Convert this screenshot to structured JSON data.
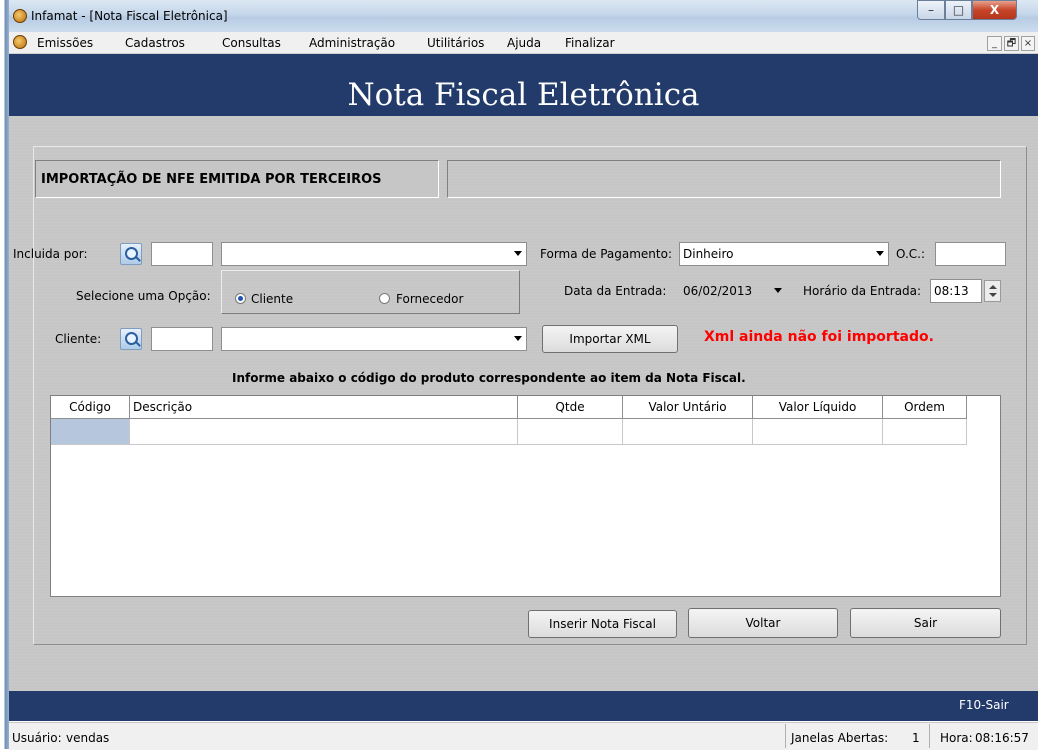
{
  "window": {
    "title": "Infamat - [Nota Fiscal Eletrônica]",
    "min": "–",
    "max": "□",
    "close": "X"
  },
  "menu": {
    "items": [
      "Emissões",
      "Cadastros",
      "Consultas",
      "Administração",
      "Utilitários",
      "Ajuda",
      "Finalizar"
    ],
    "mdi_min": "_",
    "mdi_restore": "🗗",
    "mdi_close": "×"
  },
  "banner": {
    "title": "Nota Fiscal Eletrônica"
  },
  "form": {
    "heading": "IMPORTAÇÃO DE NFE EMITIDA POR TERCEIROS",
    "incluida_label": "Incluida por:",
    "incluida_code": "",
    "incluida_name": "",
    "opcao_label": "Selecione uma Opção:",
    "opt_cliente": "Cliente",
    "opt_fornecedor": "Fornecedor",
    "cliente_label": "Cliente:",
    "cliente_code": "",
    "cliente_name": "",
    "pagamento_label": "Forma de Pagamento:",
    "pagamento_value": "Dinheiro",
    "oc_label": "O.C.:",
    "oc_value": "",
    "data_label": "Data da Entrada:",
    "data_value": "06/02/2013",
    "hora_label": "Horário da Entrada:",
    "hora_value": "08:13",
    "importar_button": "Importar XML",
    "xml_status": "Xml ainda não foi importado.",
    "grid_instruction": "Informe abaixo o código do produto correspondente ao item da Nota Fiscal."
  },
  "grid": {
    "columns": [
      "Código",
      "Descrição",
      "Qtde",
      "Valor Untário",
      "Valor Líquido",
      "Ordem"
    ]
  },
  "buttons": {
    "inserir": "Inserir Nota Fiscal",
    "voltar": "Voltar",
    "sair": "Sair"
  },
  "footer": {
    "shortcut": "F10-Sair"
  },
  "statusbar": {
    "usuario_label": "Usuário:",
    "usuario_value": "vendas",
    "janelas_label": "Janelas Abertas:",
    "janelas_value": "1",
    "hora_label": "Hora:",
    "hora_value": "08:16:57"
  },
  "colors": {
    "banner": "#223b6b",
    "content": "#c6c6c6",
    "warning": "#ff0000",
    "grid_selected": "#b5c6dd"
  }
}
